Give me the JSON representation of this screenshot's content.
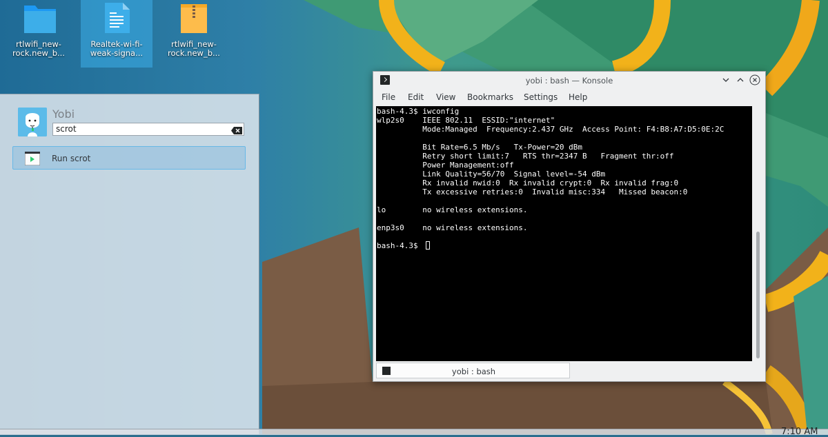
{
  "desktop": {
    "icons": [
      {
        "label_line1": "rtlwifi_new-",
        "label_line2": "rock.new_b...",
        "kind": "folder-icon"
      },
      {
        "label_line1": "Realtek-wi-fi-",
        "label_line2": "weak-signa...",
        "kind": "document-icon"
      },
      {
        "label_line1": "rtlwifi_new-",
        "label_line2": "rock.new_b...",
        "kind": "archive-icon"
      }
    ]
  },
  "launcher": {
    "username": "Yobi",
    "query": "scrot",
    "result": {
      "label": "Run scrot",
      "icon": "terminal-run-icon"
    }
  },
  "konsole": {
    "title": "yobi : bash — Konsole",
    "menu": [
      "File",
      "Edit",
      "View",
      "Bookmarks",
      "Settings",
      "Help"
    ],
    "terminal_text": "bash-4.3$ iwconfig\nwlp2s0    IEEE 802.11  ESSID:\"internet\"\n          Mode:Managed  Frequency:2.437 GHz  Access Point: F4:B8:A7:D5:0E:2C\n\n          Bit Rate=6.5 Mb/s   Tx-Power=20 dBm\n          Retry short limit:7   RTS thr=2347 B   Fragment thr:off\n          Power Management:off\n          Link Quality=56/70  Signal level=-54 dBm\n          Rx invalid nwid:0  Rx invalid crypt:0  Rx invalid frag:0\n          Tx excessive retries:0  Invalid misc:334   Missed beacon:0\n\nlo        no wireless extensions.\n\nenp3s0    no wireless extensions.\n\nbash-4.3$ ",
    "tab_label": "yobi : bash"
  },
  "panel": {
    "clock": "7:10 AM"
  },
  "colors": {
    "accent": "#3daee9",
    "ring_yellow": "#f2b21a",
    "terminal_bg": "#000000"
  }
}
